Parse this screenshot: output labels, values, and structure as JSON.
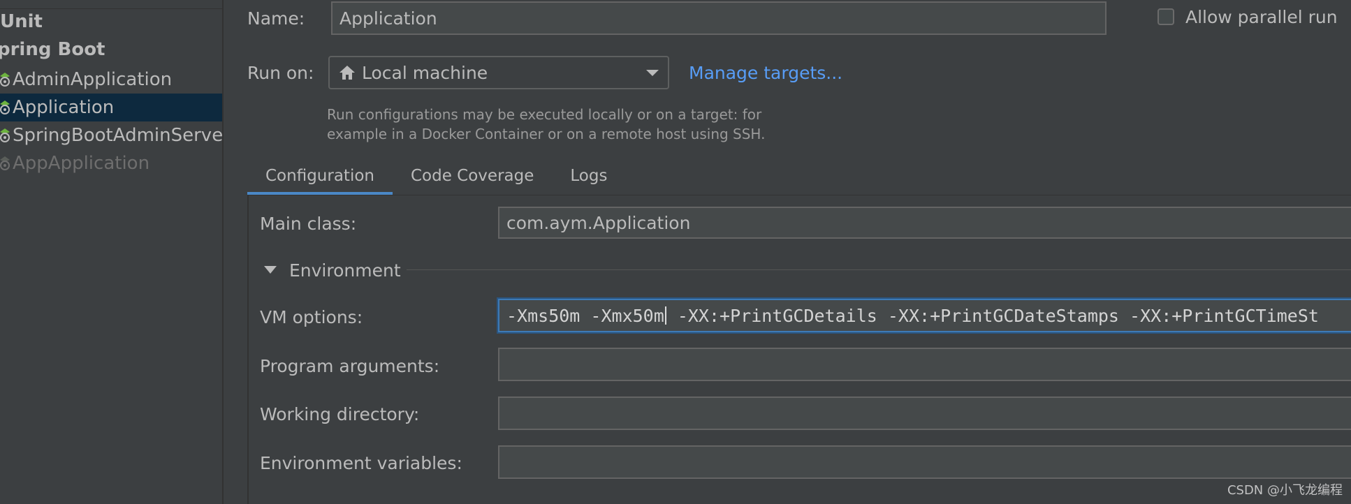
{
  "sidebar": {
    "groups": [
      {
        "label": "Unit"
      },
      {
        "label": "pring Boot"
      }
    ],
    "items": [
      {
        "label": "AdminApplication",
        "state": "normal"
      },
      {
        "label": "Application",
        "state": "selected"
      },
      {
        "label": "SpringBootAdminServer",
        "state": "normal"
      },
      {
        "label": "AppApplication",
        "state": "disabled"
      }
    ]
  },
  "form": {
    "name_label": "Name:",
    "name_value": "Application",
    "allow_parallel_label": "Allow parallel run",
    "allow_parallel_checked": false,
    "run_on_label": "Run on:",
    "run_on_value": "Local machine",
    "manage_targets_link": "Manage targets...",
    "hint_line1": "Run configurations may be executed locally or on a target: for",
    "hint_line2": "example in a Docker Container or on a remote host using SSH."
  },
  "tabs": [
    {
      "label": "Configuration",
      "active": true
    },
    {
      "label": "Code Coverage",
      "active": false
    },
    {
      "label": "Logs",
      "active": false
    }
  ],
  "configuration": {
    "main_class_label": "Main class:",
    "main_class_value": "com.aym.Application",
    "environment_section": "Environment",
    "vm_options_label": "VM options:",
    "vm_options_before_cursor": "-Xms50m -Xmx50m",
    "vm_options_after_cursor": " -XX:+PrintGCDetails -XX:+PrintGCDateStamps -XX:+PrintGCTimeSt",
    "program_arguments_label": "Program arguments:",
    "program_arguments_value": "",
    "working_directory_label": "Working directory:",
    "working_directory_value": "",
    "environment_variables_label": "Environment variables:",
    "environment_variables_value": ""
  },
  "watermark": "CSDN @小飞龙编程",
  "colors": {
    "background": "#3c3f41",
    "selection": "#0d293e",
    "link": "#589df6",
    "tab_underline": "#4a88c7",
    "focus_border": "#3d7ab6",
    "spring_icon": "#6db33f"
  },
  "icons": {
    "run_on": "home-icon",
    "combo": "chevron-down-icon",
    "spring": "spring-boot-icon"
  }
}
